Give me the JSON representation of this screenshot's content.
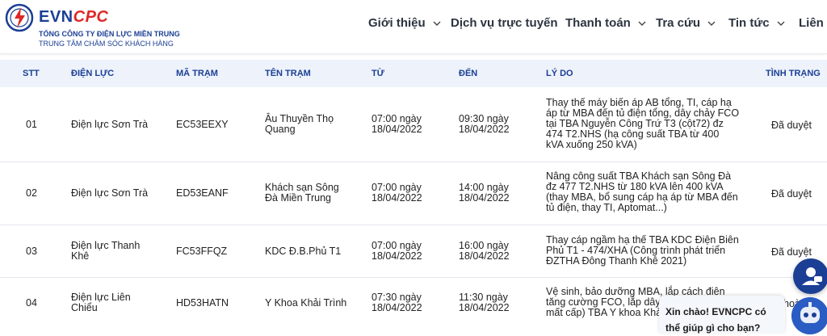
{
  "brand": {
    "evn": "EVN",
    "cpc": "CPC",
    "line1": "TỔNG CÔNG TY ĐIỆN LỰC MIỀN TRUNG",
    "line2": "TRUNG TÂM CHĂM SÓC KHÁCH HÀNG"
  },
  "nav": [
    "Giới thiệu",
    "Dịch vụ trực tuyến",
    "Thanh toán",
    "Tra cứu",
    "Tin tức",
    "Liên h"
  ],
  "table": {
    "headers": [
      "STT",
      "ĐIỆN LỰC",
      "MÃ TRẠM",
      "TÊN TRẠM",
      "TỪ",
      "ĐẾN",
      "LÝ DO",
      "TÌNH TRẠNG"
    ],
    "rows": [
      {
        "stt": "01",
        "dien_luc": [
          "Điện lực Sơn Trà"
        ],
        "ma_tram": "EC53EEXY",
        "ten_tram": [
          "Âu Thuyền Thọ",
          "Quang"
        ],
        "tu": [
          "07:00 ngày",
          "18/04/2022"
        ],
        "den": [
          "09:30 ngày",
          "18/04/2022"
        ],
        "ly_do": [
          "Thay thế máy biến áp AB tổng, TI, cáp hạ",
          "áp từ MBA đến tủ điện tổng, dây chảy FCO",
          "tại TBA Nguyễn Công Trứ T3 (cột72) đz",
          "474 T2.NHS (hạ công suất TBA từ 400",
          "kVA xuống 250 kVA)"
        ],
        "tinh_trang": "Đã duyệt"
      },
      {
        "stt": "02",
        "dien_luc": [
          "Điện lực Sơn Trà"
        ],
        "ma_tram": "ED53EANF",
        "ten_tram": [
          "Khách sạn Sông",
          "Đà Miền Trung"
        ],
        "tu": [
          "07:00 ngày",
          "18/04/2022"
        ],
        "den": [
          "14:00 ngày",
          "18/04/2022"
        ],
        "ly_do": [
          "Nâng công suất TBA Khách sạn Sông Đà",
          "đz 477 T2.NHS từ 180 kVA lên 400 kVA",
          "(thay MBA, bổ sung cáp hạ áp từ MBA đến",
          "tủ điện, thay TI, Aptomat...)"
        ],
        "tinh_trang": "Đã duyệt"
      },
      {
        "stt": "03",
        "dien_luc": [
          "Điện lực Thanh",
          "Khê"
        ],
        "ma_tram": "FC53FFQZ",
        "ten_tram": [
          "KDC Đ.B.Phủ T1"
        ],
        "tu": [
          "07:00 ngày",
          "18/04/2022"
        ],
        "den": [
          "16:00 ngày",
          "18/04/2022"
        ],
        "ly_do": [
          "Thay cáp ngầm hạ thế TBA KDC Điện Biên",
          "Phủ T1 - 474/XHA (Công trình phát triển",
          "ĐZTHA Đông Thanh Khê 2021)"
        ],
        "tinh_trang": "Đã duyệt"
      },
      {
        "stt": "04",
        "dien_luc": [
          "Điện lực Liên",
          "Chiểu"
        ],
        "ma_tram": "HD53HATN",
        "ten_tram": [
          "Y Khoa Khải Trình"
        ],
        "tu": [
          "07:30 ngày",
          "18/04/2022"
        ],
        "den": [
          "11:30 ngày",
          "18/04/2022"
        ],
        "ly_do": [
          "Vệ sinh, bảo dưỡng MBA, lắp cách điện",
          "tăng cường FCO, lắp dây t",
          "mất cấp) TBA Y khoa Khả"
        ],
        "tinh_trang": "hoàn"
      }
    ]
  },
  "chat": {
    "greeting": [
      "Xin chào! EVNCPC có",
      "thể giúp gì cho bạn?"
    ]
  },
  "colors": {
    "brand_blue": "#1b3f95",
    "brand_red": "#e02626",
    "header_bg": "#edf2fb"
  },
  "icons": {
    "logo": "evn-lightning-logo-icon",
    "nav_dropdown": "chevron-down-icon",
    "chat": "support-chat-icon",
    "bot": "chatbot-avatar-icon"
  }
}
